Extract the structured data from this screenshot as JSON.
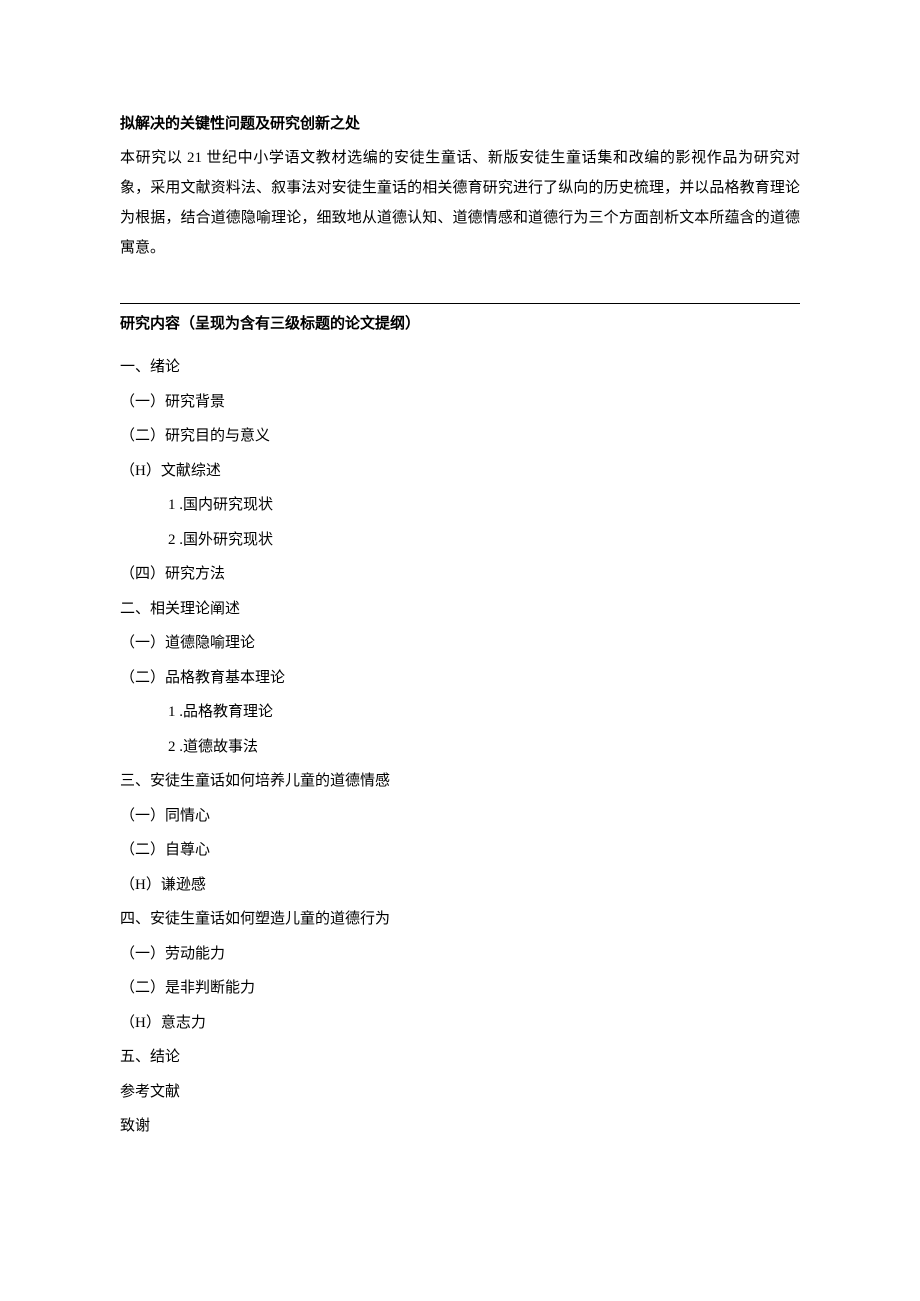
{
  "section1": {
    "heading": "拟解决的关键性问题及研究创新之处",
    "paragraph": "本研究以 21 世纪中小学语文教材选编的安徒生童话、新版安徒生童话集和改编的影视作品为研究对象，采用文献资料法、叙事法对安徒生童话的相关德育研究进行了纵向的历史梳理，并以品格教育理论为根据，结合道德隐喻理论，细致地从道德认知、道德情感和道德行为三个方面剖析文本所蕴含的道德寓意。"
  },
  "section2": {
    "heading": "研究内容（呈现为含有三级标题的论文提纲）",
    "outline": [
      {
        "level": 1,
        "text": "一、绪论"
      },
      {
        "level": 2,
        "text": "（一）研究背景"
      },
      {
        "level": 2,
        "text": "（二）研究目的与意义"
      },
      {
        "level": 2,
        "text": "（H）文献综述"
      },
      {
        "level": 3,
        "text": "1 .国内研究现状"
      },
      {
        "level": 3,
        "text": "2   .国外研究现状"
      },
      {
        "level": 2,
        "text": "（四）研究方法"
      },
      {
        "level": 1,
        "text": "二、相关理论阐述"
      },
      {
        "level": 2,
        "text": "（一）道德隐喻理论"
      },
      {
        "level": 2,
        "text": "（二）品格教育基本理论"
      },
      {
        "level": 3,
        "text": "1 .品格教育理论"
      },
      {
        "level": 3,
        "text": "2   .道德故事法"
      },
      {
        "level": 1,
        "text": "三、安徒生童话如何培养儿童的道德情感"
      },
      {
        "level": 2,
        "text": "（一）同情心"
      },
      {
        "level": 2,
        "text": "（二）自尊心"
      },
      {
        "level": 2,
        "text": "（H）谦逊感"
      },
      {
        "level": 1,
        "text": "四、安徒生童话如何塑造儿童的道德行为"
      },
      {
        "level": 2,
        "text": "（一）劳动能力"
      },
      {
        "level": 2,
        "text": "（二）是非判断能力"
      },
      {
        "level": 2,
        "text": "（H）意志力"
      },
      {
        "level": 1,
        "text": "五、结论"
      },
      {
        "level": 1,
        "text": "参考文献"
      },
      {
        "level": 1,
        "text": "致谢"
      }
    ]
  }
}
